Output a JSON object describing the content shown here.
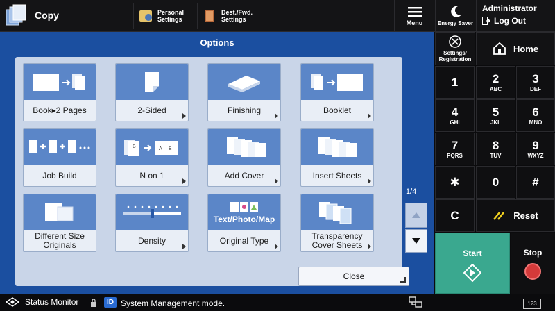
{
  "header": {
    "app_title": "Copy",
    "personal_settings": "Personal Settings",
    "dest_fwd_settings": "Dest./Fwd. Settings",
    "menu": "Menu",
    "energy_saver": "Energy Saver",
    "admin_name": "Administrator",
    "logout": "Log Out"
  },
  "options": {
    "title": "Options",
    "tiles": [
      {
        "label": "Book▸2 Pages",
        "icon": "book-to-2-pages-icon"
      },
      {
        "label": "2-Sided",
        "icon": "two-sided-icon"
      },
      {
        "label": "Finishing",
        "icon": "finishing-icon"
      },
      {
        "label": "Booklet",
        "icon": "booklet-icon"
      },
      {
        "label": "Job Build",
        "icon": "job-build-icon"
      },
      {
        "label": "N on 1",
        "icon": "n-on-1-icon"
      },
      {
        "label": "Add Cover",
        "icon": "add-cover-icon"
      },
      {
        "label": "Insert Sheets",
        "icon": "insert-sheets-icon"
      },
      {
        "label": "Different Size Originals",
        "icon": "different-size-originals-icon"
      },
      {
        "label": "Density",
        "icon": "density-slider-icon"
      },
      {
        "label": "Original Type",
        "icon": "original-type-icon",
        "pic_text": "Text/Photo/Map"
      },
      {
        "label": "Transparency Cover Sheets",
        "icon": "transparency-cover-sheets-icon"
      }
    ],
    "page_indicator": "1/4",
    "close": "Close"
  },
  "side": {
    "settings_registration": "Settings/ Registration",
    "home": "Home",
    "keys": [
      {
        "d": "1",
        "l": ""
      },
      {
        "d": "2",
        "l": "ABC"
      },
      {
        "d": "3",
        "l": "DEF"
      },
      {
        "d": "4",
        "l": "GHI"
      },
      {
        "d": "5",
        "l": "JKL"
      },
      {
        "d": "6",
        "l": "MNO"
      },
      {
        "d": "7",
        "l": "PQRS"
      },
      {
        "d": "8",
        "l": "TUV"
      },
      {
        "d": "9",
        "l": "WXYZ"
      },
      {
        "d": "✱",
        "l": ""
      },
      {
        "d": "0",
        "l": ""
      },
      {
        "d": "#",
        "l": ""
      },
      {
        "d": "C",
        "l": ""
      }
    ],
    "reset": "Reset",
    "start": "Start",
    "stop": "Stop"
  },
  "status": {
    "status_monitor": "Status Monitor",
    "id_badge": "ID",
    "message": "System Management mode.",
    "keyboard": "123"
  },
  "colors": {
    "panel_blue": "#1b4fa0",
    "tile_blue": "#5b86c8",
    "start_green": "#3aa88f",
    "stop_red": "#d43a3a"
  }
}
